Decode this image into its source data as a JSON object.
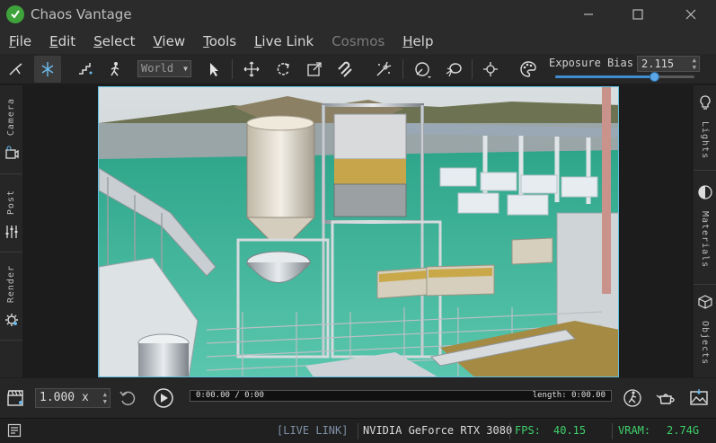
{
  "window": {
    "title": "Chaos Vantage"
  },
  "menu": [
    {
      "underline": "F",
      "rest": "ile",
      "disabled": false
    },
    {
      "underline": "E",
      "rest": "dit",
      "disabled": false
    },
    {
      "underline": "S",
      "rest": "elect",
      "disabled": false
    },
    {
      "underline": "V",
      "rest": "iew",
      "disabled": false
    },
    {
      "underline": "T",
      "rest": "ools",
      "disabled": false
    },
    {
      "underline": "L",
      "rest": "ive Link",
      "disabled": false
    },
    {
      "underline": "",
      "rest": "Cosmos",
      "disabled": true
    },
    {
      "underline": "H",
      "rest": "elp",
      "disabled": false
    }
  ],
  "toolbar": {
    "coord_space": "World",
    "exposure_label": "Exposure Bias",
    "exposure_value": "2.115",
    "exposure_fraction": 0.71
  },
  "left_panel": {
    "tabs": [
      "Camera",
      "Post",
      "Render"
    ]
  },
  "right_panel": {
    "tabs": [
      "Lights",
      "Materials",
      "Objects"
    ]
  },
  "timeline": {
    "speed": "1.000 x",
    "current_time": "0:00.00 / 0:00",
    "length": "length: 0:00.00"
  },
  "status": {
    "live_link": "[LIVE LINK]",
    "gpu": "NVIDIA GeForce RTX 3080",
    "fps_label": "FPS:",
    "fps_value": "40.15",
    "vram_label": "VRAM:",
    "vram_value": "2.74G"
  },
  "colors": {
    "accent": "#3e8ed0",
    "viewport_border": "#5fbfe0",
    "status_green": "#3fd16b",
    "live_link": "#7f90a6"
  }
}
